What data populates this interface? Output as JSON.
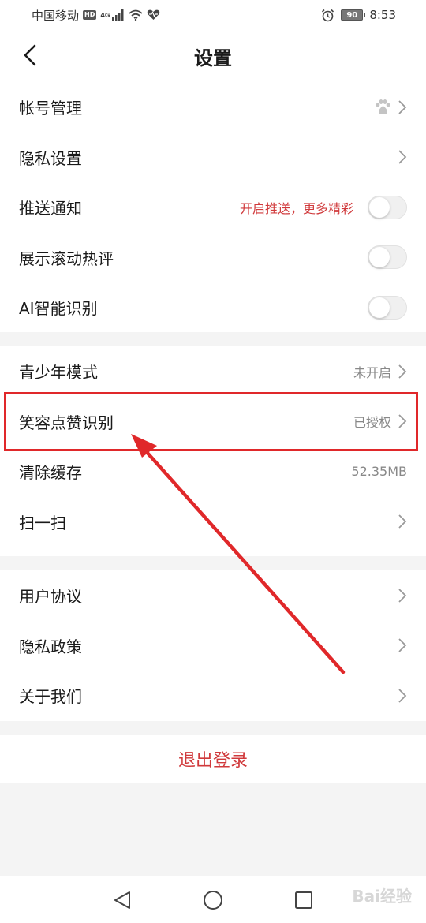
{
  "status_bar": {
    "carrier": "中国移动",
    "hd": "HD",
    "network": "4G",
    "battery": "90",
    "time": "8:53"
  },
  "header": {
    "title": "设置"
  },
  "groups": [
    {
      "rows": [
        {
          "label": "帐号管理",
          "type": "link",
          "icon": "paw-icon"
        },
        {
          "label": "隐私设置",
          "type": "link"
        },
        {
          "label": "推送通知",
          "type": "toggle",
          "hint": "开启推送，更多精彩",
          "on": false
        },
        {
          "label": "展示滚动热评",
          "type": "toggle",
          "on": false
        },
        {
          "label": "AI智能识别",
          "type": "toggle",
          "on": false
        }
      ]
    },
    {
      "rows": [
        {
          "label": "青少年模式",
          "type": "link",
          "value": "未开启"
        },
        {
          "label": "笑容点赞识别",
          "type": "link",
          "value": "已授权"
        },
        {
          "label": "清除缓存",
          "type": "value",
          "value": "52.35MB"
        },
        {
          "label": "扫一扫",
          "type": "link"
        }
      ]
    },
    {
      "rows": [
        {
          "label": "用户协议",
          "type": "link"
        },
        {
          "label": "隐私政策",
          "type": "link"
        },
        {
          "label": "关于我们",
          "type": "link"
        }
      ]
    }
  ],
  "logout_label": "退出登录",
  "watermark": "Bai经验",
  "colors": {
    "accent": "#d0393b",
    "annotation": "#e0282a",
    "background": "#f4f4f4"
  }
}
